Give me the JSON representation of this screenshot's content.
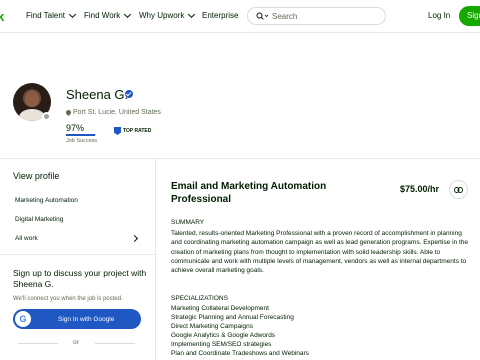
{
  "nav": {
    "logo_fragment": "k",
    "links": [
      "Find Talent",
      "Find Work",
      "Why Upwork",
      "Enterprise"
    ],
    "search_placeholder": "Search",
    "login": "Log In",
    "signup": "Sign"
  },
  "profile": {
    "name": "Sheena G.",
    "location": "Port St. Lucie, United States",
    "job_success_pct": "97%",
    "job_success_value": 0.97,
    "job_success_label": "Job Success",
    "badge": "TOP RATED"
  },
  "sidebar": {
    "heading": "View profile",
    "items": [
      "Marketing Automation",
      "Digital Marketing",
      "All work"
    ],
    "signup_title": "Sign up to discuss your project with Sheena G.",
    "signup_sub": "We'll connect you when the job is posted.",
    "google_button": "Sign In with Google",
    "or": "or"
  },
  "main": {
    "title": "Email and Marketing Automation Professional",
    "rate": "$75.00/hr",
    "summary_heading": "SUMMARY",
    "summary_body": "Talented, results-oriented Marketing Professional with a proven record of accomplishment in planning and coordinating marketing automation campaign as well as lead generation programs. Expertise in the creation of marketing plans from thought to implementation with solid leadership skills. Able to communicate and work with multiple levels of management, vendors as well as internal departments to achieve overall marketing goals.",
    "specializations_heading": "SPECIALIZATIONS",
    "specializations": [
      "Marketing Collateral Development",
      "Strategic Planning and Annual Forecasting",
      "Direct Marketing Campaigns",
      "Google Analytics & Google Adwords",
      "Implementing SEM/SEO strategies",
      "Plan and Coordinate Tradeshows and Webinars"
    ]
  },
  "colors": {
    "brand_green": "#14a800",
    "accent_blue": "#1f57c3",
    "text": "#001e00",
    "muted": "#5e6d55"
  }
}
